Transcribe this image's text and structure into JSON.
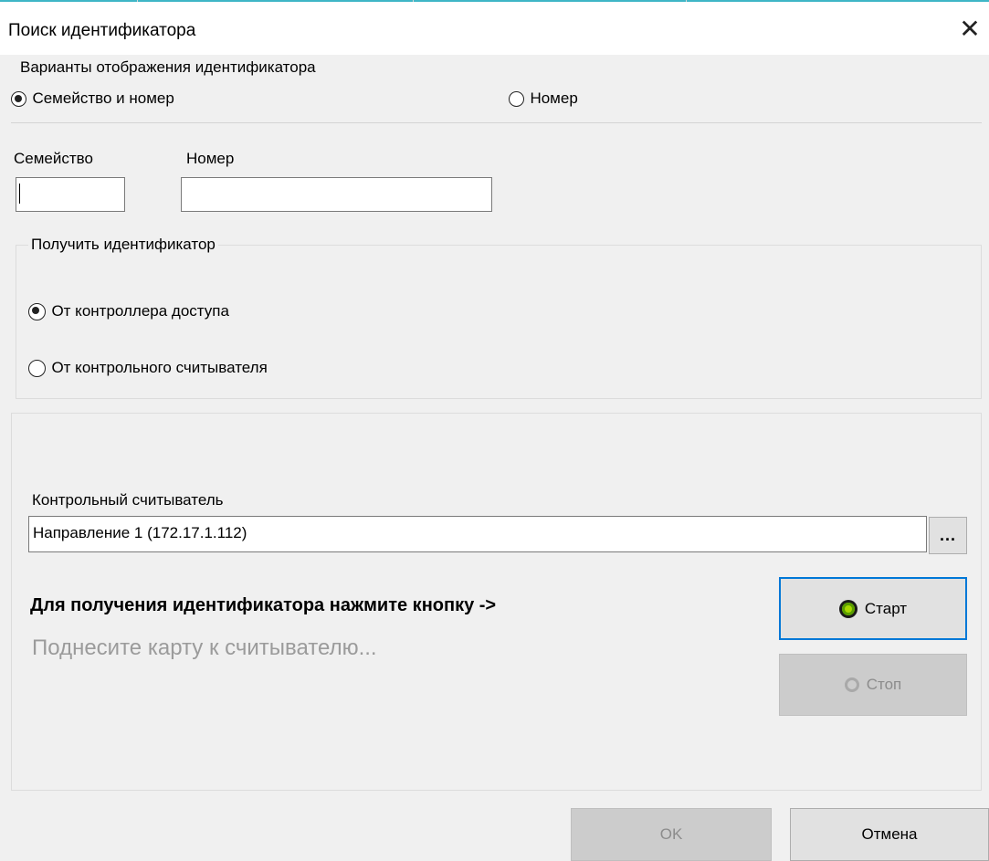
{
  "window": {
    "title": "Поиск идентификатора",
    "close_glyph": "✕"
  },
  "display_options": {
    "legend": "Варианты отображения идентификатора",
    "family_and_number": {
      "label": "Семейство и номер",
      "checked": true
    },
    "number_only": {
      "label": "Номер",
      "checked": false
    }
  },
  "fields": {
    "family_label": "Семейство",
    "family_value": "",
    "number_label": "Номер",
    "number_value": ""
  },
  "source": {
    "legend": "Получить идентификатор",
    "from_controller": {
      "label": "От контроллера доступа",
      "checked": true
    },
    "from_reader": {
      "label": "От контрольного считывателя",
      "checked": false
    }
  },
  "reader": {
    "label": "Контрольный считыватель",
    "value": "Направление 1 (172.17.1.112)",
    "browse_label": "..."
  },
  "instructions": {
    "press_button": "Для получения идентификатора нажмите кнопку ->",
    "present_card": "Поднесите карту к считывателю..."
  },
  "buttons": {
    "start": "Старт",
    "stop": "Стоп",
    "ok": "OK",
    "cancel": "Отмена"
  },
  "colors": {
    "accent": "#0078d7",
    "top_line": "#3fb6c6",
    "start_icon": "#a8d800"
  },
  "icons": {
    "close": "close-icon",
    "start": "start-indicator-icon",
    "stop": "stop-indicator-icon"
  }
}
